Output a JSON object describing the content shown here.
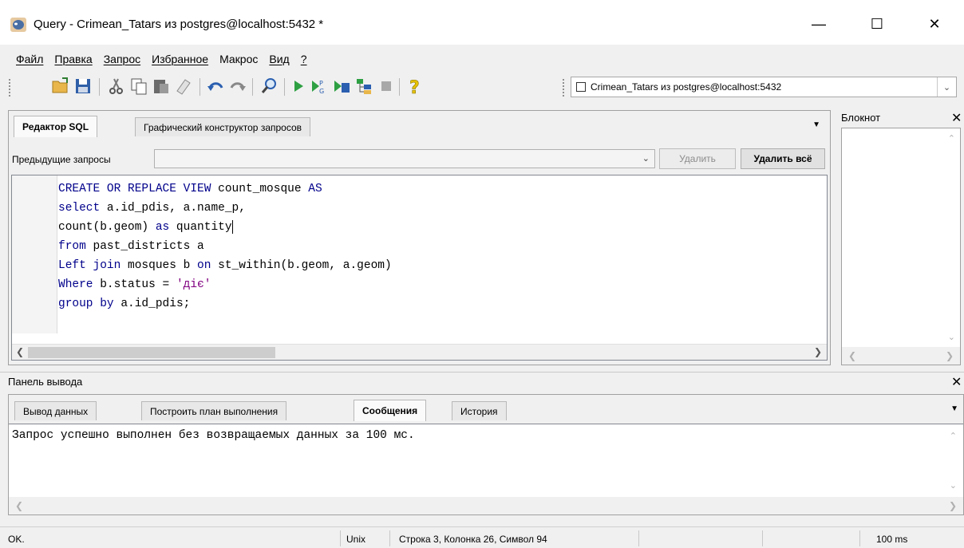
{
  "window": {
    "title": "Query - Crimean_Tatars из postgres@localhost:5432 *",
    "min_glyph": "—",
    "max_glyph": "☐",
    "close_glyph": "✕"
  },
  "menu": {
    "items": [
      "Файл",
      "Правка",
      "Запрос",
      "Избранное",
      "Макрос",
      "Вид",
      "?"
    ]
  },
  "toolbar": {
    "connection": "Crimean_Tatars из postgres@localhost:5432",
    "dropdown_glyph": "⌄"
  },
  "editor": {
    "tabs": [
      "Редактор SQL",
      "Графический конструктор запросов"
    ],
    "previous_label": "Предыдущие запросы",
    "delete_label": "Удалить",
    "delete_all_label": "Удалить всё",
    "code": {
      "l1_kw": "CREATE OR REPLACE VIEW",
      "l1_rest": " count_mosque ",
      "l1_kw2": "AS",
      "l2_kw": "select",
      "l2_rest": " a.id_pdis, a.name_p,",
      "l3_a": "count(b.geom) ",
      "l3_kw": "as",
      "l3_b": " quantity",
      "l4_kw": "from",
      "l4_rest": " past_districts a",
      "l5_kw": "Left join",
      "l5_a": " mosques b ",
      "l5_kw2": "on",
      "l5_b": " st_within(b.geom, a.geom)",
      "l6_kw": "Where",
      "l6_a": " b.status = ",
      "l6_str": "'діє'",
      "l7_kw": "group by",
      "l7_rest": " a.id_pdis;"
    }
  },
  "notepad": {
    "title": "Блокнот"
  },
  "output": {
    "title": "Панель вывода",
    "tabs": [
      "Вывод данных",
      "Построить план выполнения",
      "Сообщения",
      "История"
    ],
    "message": "Запрос успешно выполнен без возвращаемых данных за 100 мс."
  },
  "status": {
    "state": "OK.",
    "line_ending": "Unix",
    "position": "Строка 3, Колонка 26, Символ 94",
    "time": "100 ms"
  },
  "colors": {
    "keyword": "#00008b",
    "string": "#800080"
  }
}
